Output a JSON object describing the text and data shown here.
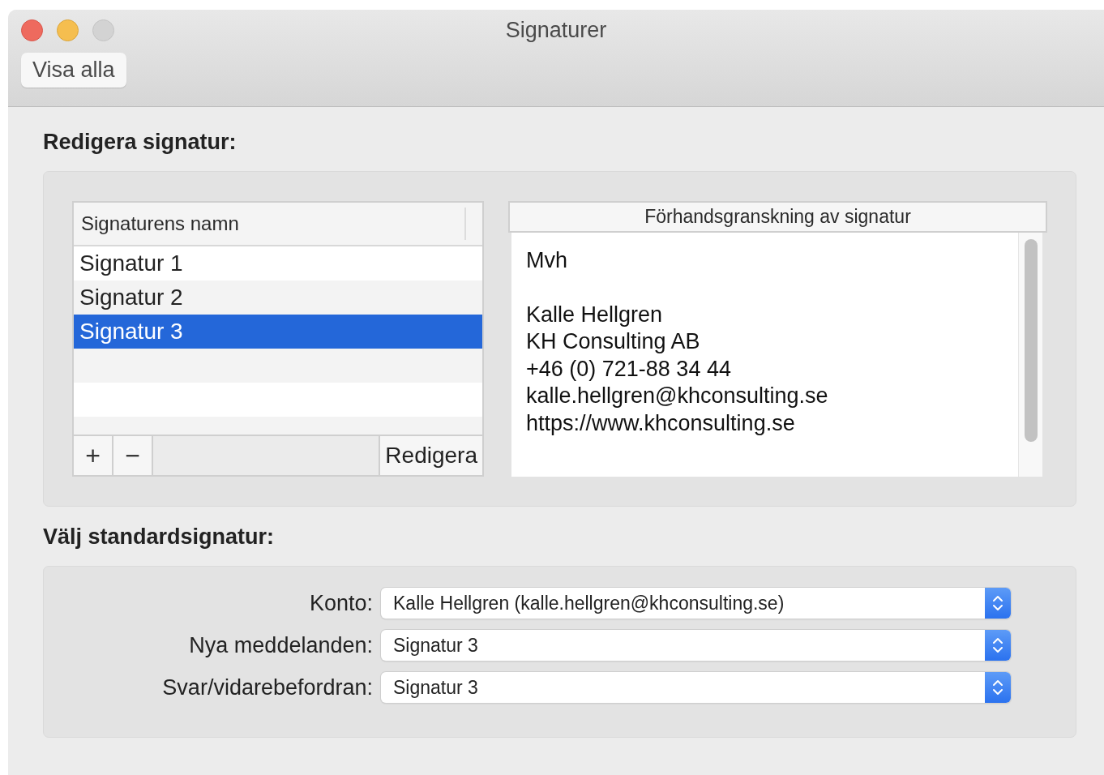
{
  "window": {
    "title": "Signaturer",
    "toolbar_button": "Visa alla"
  },
  "edit_section": {
    "heading": "Redigera signatur:",
    "list": {
      "column": "Signaturens namn",
      "items": [
        {
          "name": "Signatur 1",
          "selected": false
        },
        {
          "name": "Signatur 2",
          "selected": false
        },
        {
          "name": "Signatur 3",
          "selected": true
        }
      ],
      "add_button": "+",
      "remove_button": "−",
      "edit_button": "Redigera"
    },
    "preview": {
      "heading": "Förhandsgranskning av signatur",
      "paragraphs": [
        [
          "Mvh"
        ],
        [
          "Kalle Hellgren",
          "KH Consulting AB",
          "+46 (0) 721-88 34 44",
          "kalle.hellgren@khconsulting.se",
          "https://www.khconsulting.se"
        ]
      ]
    }
  },
  "default_section": {
    "heading": "Välj standardsignatur:",
    "rows": [
      {
        "label": "Konto:",
        "value": "Kalle Hellgren (kalle.hellgren@khconsulting.se)"
      },
      {
        "label": "Nya meddelanden:",
        "value": "Signatur 3"
      },
      {
        "label": "Svar/vidarebefordran:",
        "value": "Signatur 3"
      }
    ]
  }
}
